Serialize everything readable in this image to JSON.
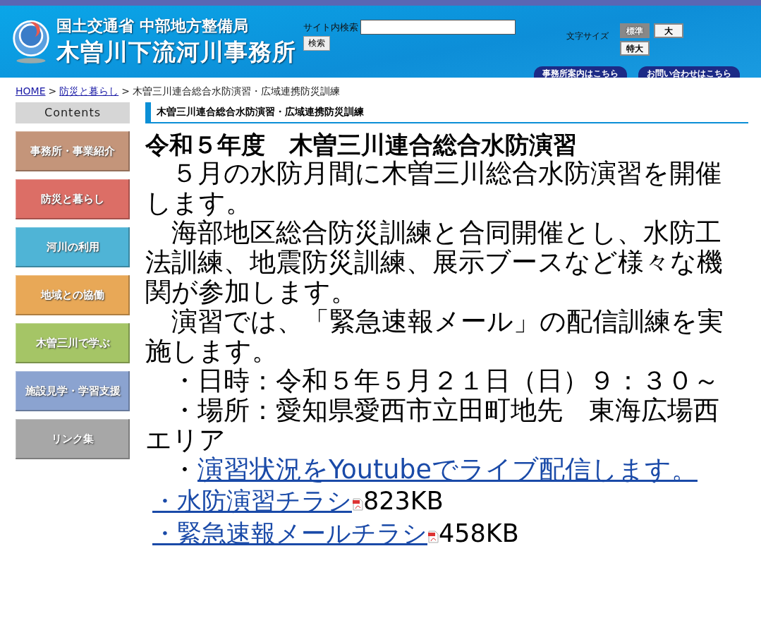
{
  "header": {
    "agency": "国土交通省 中部地方整備局",
    "office": "木曽川下流河川事務所",
    "search_label": "サイト内検索",
    "search_button": "検索",
    "font_size_label": "文字サイズ",
    "font_sizes": [
      {
        "label": "標準",
        "selected": true
      },
      {
        "label": "大",
        "selected": false
      },
      {
        "label": "特大",
        "selected": false
      }
    ],
    "links": [
      "事務所案内はこちら",
      "お問い合わせはこちら"
    ]
  },
  "breadcrumb_separator": ">",
  "breadcrumb": [
    {
      "label": "HOME",
      "link": true
    },
    {
      "label": "防災と暮らし",
      "link": true
    },
    {
      "label": "木曽三川連合総合水防演習・広域連携防災訓練",
      "link": false
    }
  ],
  "sidebar": {
    "title": "Contents",
    "items": [
      {
        "label": "事務所・事業紹介",
        "color": "#c4957a"
      },
      {
        "label": "防災と暮らし",
        "color": "#dc6e66"
      },
      {
        "label": "河川の利用",
        "color": "#4fb4d6"
      },
      {
        "label": "地域との協働",
        "color": "#e8a857"
      },
      {
        "label": "木曽三川で学ぶ",
        "color": "#a5c566"
      },
      {
        "label": "施設見学・学習支援",
        "color": "#8ba3d0"
      },
      {
        "label": "リンク集",
        "color": "#a7a7a7"
      }
    ]
  },
  "section_title": "木曽三川連合総合水防演習・広域連携防災訓練",
  "article": {
    "title": "令和５年度　木曽三川連合総合水防演習",
    "paragraphs": [
      {
        "kind": "text",
        "text": "　５月の水防月間に木曽三川総合水防演習を開催します。"
      },
      {
        "kind": "text",
        "text": "　海部地区総合防災訓練と合同開催とし、水防工法訓練、地震防災訓練、展示ブースなど様々な機関が参加します。"
      },
      {
        "kind": "text",
        "text": "　演習では、「緊急速報メール」の配信訓練を実施します。"
      },
      {
        "kind": "text",
        "text": "　・日時：令和５年５月２１日（日）９：３０～"
      },
      {
        "kind": "text",
        "text": "　・場所：愛知県愛西市立田町地先　東海広場西エリア"
      },
      {
        "kind": "link",
        "prefix": "　・",
        "text": "演習状況をYoutubeでライブ配信します。"
      }
    ],
    "attachments": [
      {
        "label": "・水防演習チラシ",
        "size": "823KB"
      },
      {
        "label": "・緊急速報メールチラシ",
        "size": "458KB"
      }
    ]
  }
}
